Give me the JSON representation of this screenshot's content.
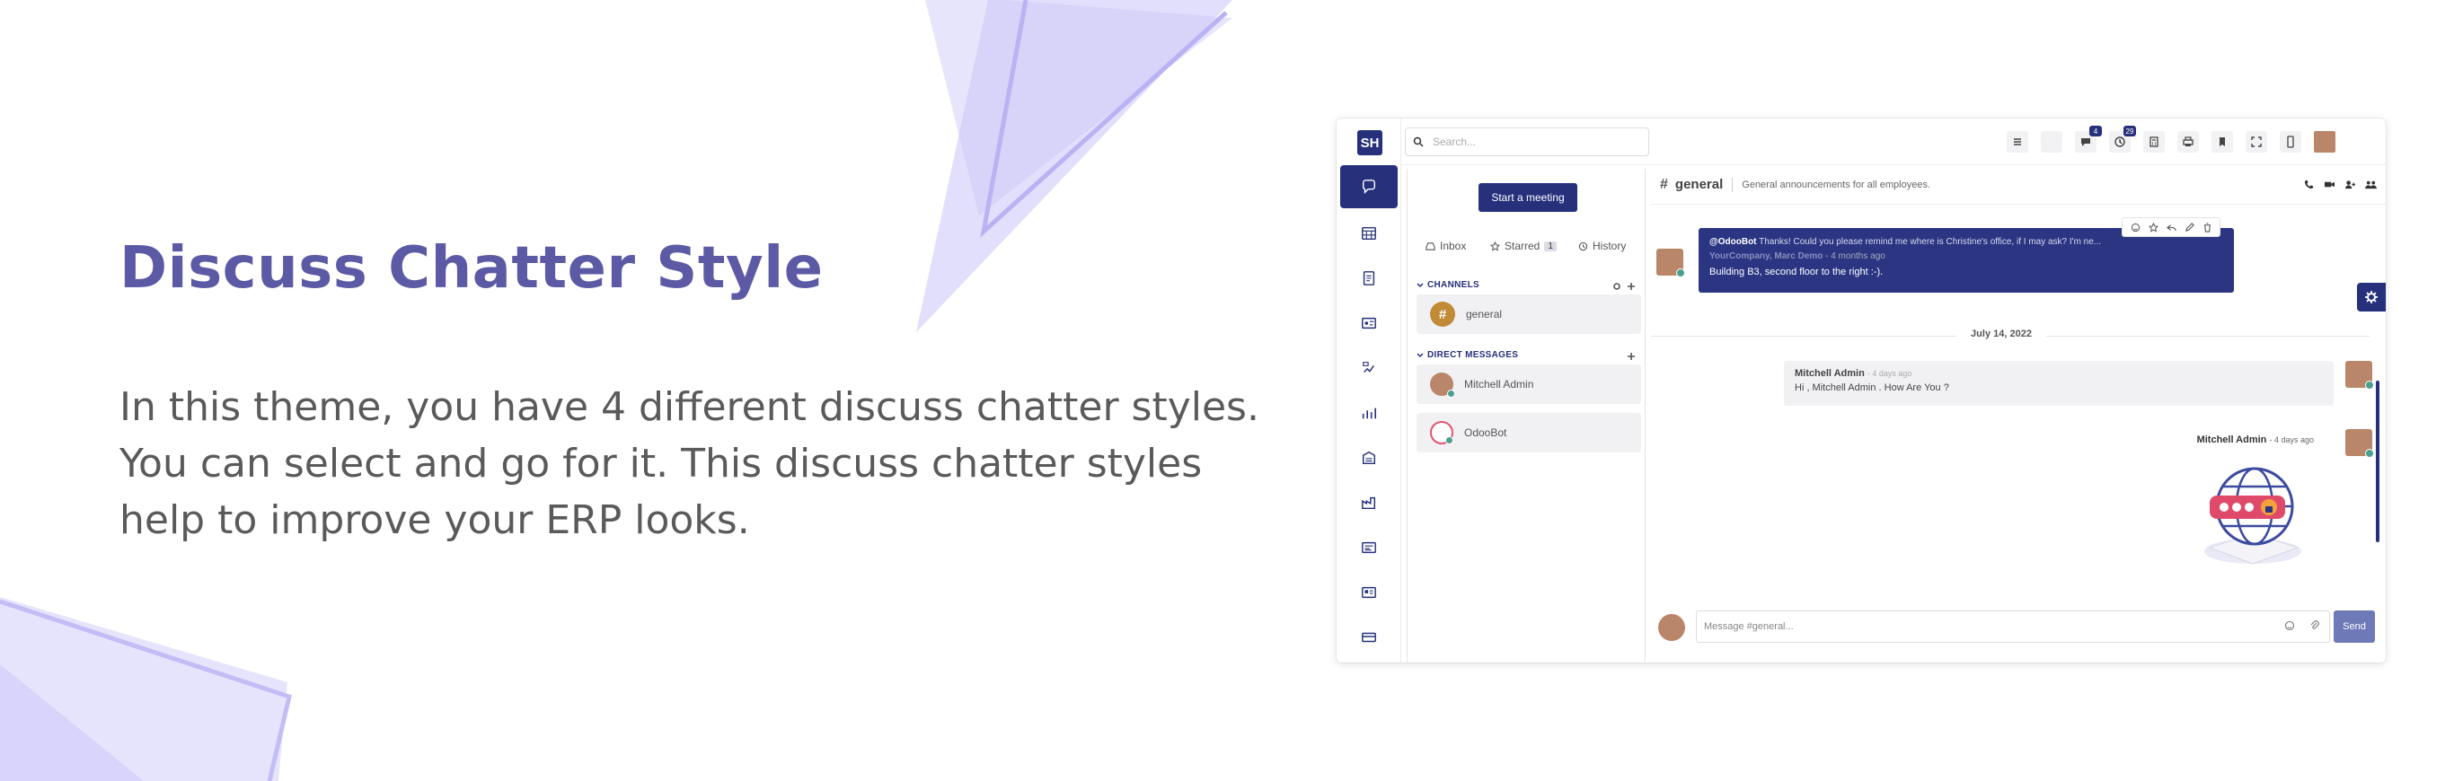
{
  "hero": {
    "headline": "Discuss Chatter Style",
    "lines": [
      "In this theme, you have 4 different discuss chatter styles.",
      "You can select and go for it. This discuss chatter styles",
      "help to improve your ERP looks."
    ]
  },
  "colors": {
    "brand": "#26307b",
    "headline": "#5d5aa5",
    "decor": "#c9c5f7",
    "send_button": "#6e79b7"
  },
  "app": {
    "logo_text": "SH",
    "search": {
      "placeholder": "Search..."
    },
    "topbar_icons": [
      "list-icon",
      "moon-icon",
      "chat-icon",
      "activity-icon",
      "calculator-icon",
      "print-icon",
      "bookmark-icon",
      "fullscreen-icon",
      "mobile-icon",
      "user-avatar"
    ],
    "badges": {
      "messages": "4",
      "activities": "29"
    },
    "sidebar_icons": [
      "discuss-icon",
      "calendar-icon",
      "invoice-icon",
      "contacts-icon",
      "crm-icon",
      "sales-icon",
      "inventory-icon",
      "manufacturing-icon",
      "website-icon",
      "employees-icon",
      "card-icon"
    ],
    "discuss": {
      "start_meeting": "Start a meeting",
      "mailboxes": [
        {
          "label": "Inbox",
          "icon": "inbox-icon"
        },
        {
          "label": "Starred",
          "icon": "star-icon",
          "count": "1"
        },
        {
          "label": "History",
          "icon": "history-icon"
        }
      ],
      "channels_header": "CHANNELS",
      "channels": [
        {
          "name": "general"
        }
      ],
      "dm_header": "DIRECT MESSAGES",
      "direct_messages": [
        {
          "name": "Mitchell Admin"
        },
        {
          "name": "OdooBot"
        }
      ]
    },
    "thread": {
      "channel_name": "general",
      "description": "General announcements for all employees.",
      "highlight": {
        "quote_mention": "@OdooBot",
        "quote_text": "Thanks! Could you please remind me where is Christine's office, if I may ask? I'm ne...",
        "author": "YourCompany, Marc Demo",
        "date": "- 4 months ago",
        "body": "Building B3, second floor to the right :-)."
      },
      "date_separator": "July 14, 2022",
      "message": {
        "author": "Mitchell Admin",
        "date": "- 4 days ago",
        "body": "Hi , Mitchell Admin . How Are You ?"
      },
      "image_message": {
        "author": "Mitchell Admin",
        "date": "- 4 days ago"
      },
      "composer_placeholder": "Message #general...",
      "send_label": "Send"
    }
  }
}
